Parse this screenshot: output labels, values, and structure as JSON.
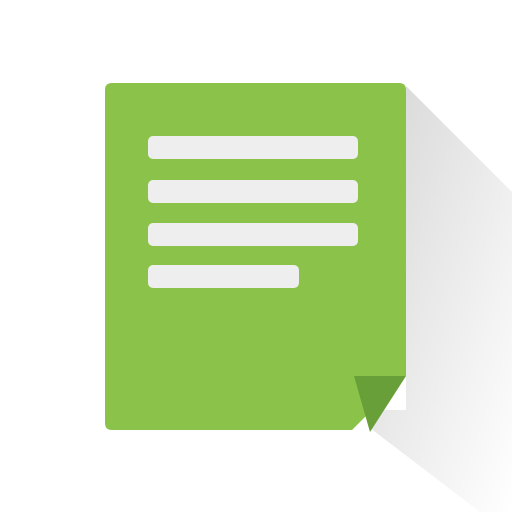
{
  "icon": {
    "name": "document-note-icon",
    "colors": {
      "background": "#ffffff",
      "page": "#8bc34a",
      "fold": "#689f38",
      "text_lines": "#eeeeee",
      "shadow": "#000000"
    },
    "text_line_count": 4
  }
}
